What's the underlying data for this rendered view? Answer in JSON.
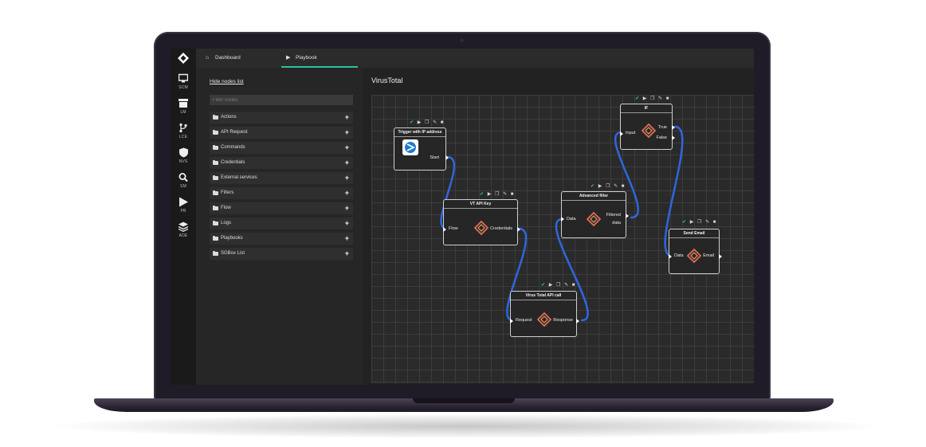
{
  "colors": {
    "accent": "#2ec29f",
    "wire": "#2f66e0",
    "check": "#3fcf6a"
  },
  "rail": [
    {
      "icon": "monitor-icon",
      "label": "SCM"
    },
    {
      "icon": "archive-icon",
      "label": "LM"
    },
    {
      "icon": "branch-icon",
      "label": "LCE"
    },
    {
      "icon": "shield-icon",
      "label": "NVS"
    },
    {
      "icon": "search-icon",
      "label": "SM"
    },
    {
      "icon": "play-icon",
      "label": "PB"
    },
    {
      "icon": "layers-icon",
      "label": "ADE"
    }
  ],
  "tabs": [
    {
      "icon": "home-icon",
      "label": "Dashboard"
    },
    {
      "icon": "play-icon",
      "label": "Playbook"
    }
  ],
  "panel": {
    "hide_link": "Hide nodes list",
    "filter_placeholder": "Filter nodes",
    "categories": [
      "Actions",
      "API Request",
      "Commands",
      "Credentials",
      "External services",
      "Filters",
      "Flow",
      "Logs",
      "Playbooks",
      "SGBox List"
    ]
  },
  "playbook": {
    "title": "VirusTotal",
    "nodes": {
      "trigger": {
        "title": "Trigger with IP address",
        "out": "Start"
      },
      "vtkey": {
        "title": "VT API Key",
        "in": "Flow",
        "out": "Credentials"
      },
      "vtcall": {
        "title": "Virus Total API call",
        "in": "Request",
        "out": "Response"
      },
      "filter": {
        "title": "Advanced filter",
        "in": "Data",
        "out1": "Filtered",
        "out2": "data"
      },
      "if": {
        "title": "IF",
        "in": "Input",
        "out_true": "True",
        "out_false": "False"
      },
      "email": {
        "title": "Send Email",
        "in": "Data",
        "out": "Email"
      }
    }
  }
}
